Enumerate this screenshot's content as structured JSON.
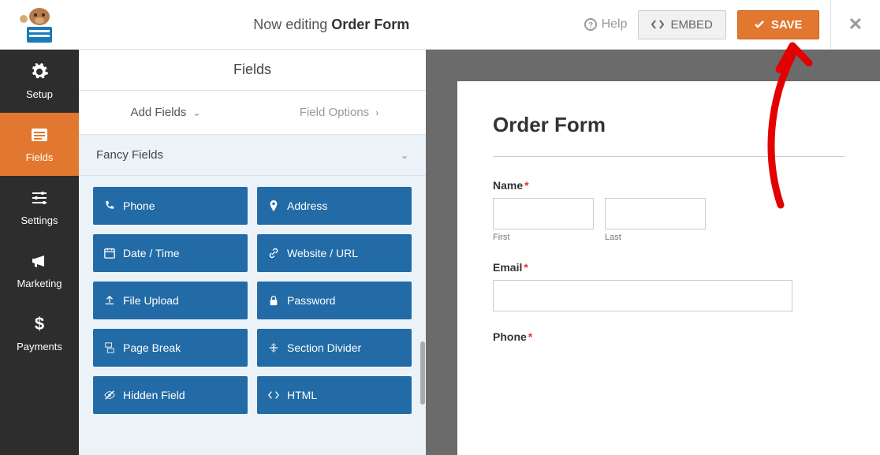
{
  "header": {
    "editing_prefix": "Now editing ",
    "form_name": "Order Form",
    "help": "Help",
    "embed": "EMBED",
    "save": "SAVE"
  },
  "sidebar": {
    "setup": "Setup",
    "fields": "Fields",
    "settings": "Settings",
    "marketing": "Marketing",
    "payments": "Payments"
  },
  "panel": {
    "title": "Fields",
    "tab_add": "Add Fields",
    "tab_options": "Field Options",
    "section": "Fancy Fields",
    "buttons": {
      "phone": "Phone",
      "address": "Address",
      "datetime": "Date / Time",
      "website": "Website / URL",
      "upload": "File Upload",
      "password": "Password",
      "pagebreak": "Page Break",
      "divider": "Section Divider",
      "hidden": "Hidden Field",
      "html": "HTML"
    }
  },
  "form": {
    "title": "Order Form",
    "name_label": "Name",
    "first": "First",
    "last": "Last",
    "email_label": "Email",
    "phone_label": "Phone"
  }
}
